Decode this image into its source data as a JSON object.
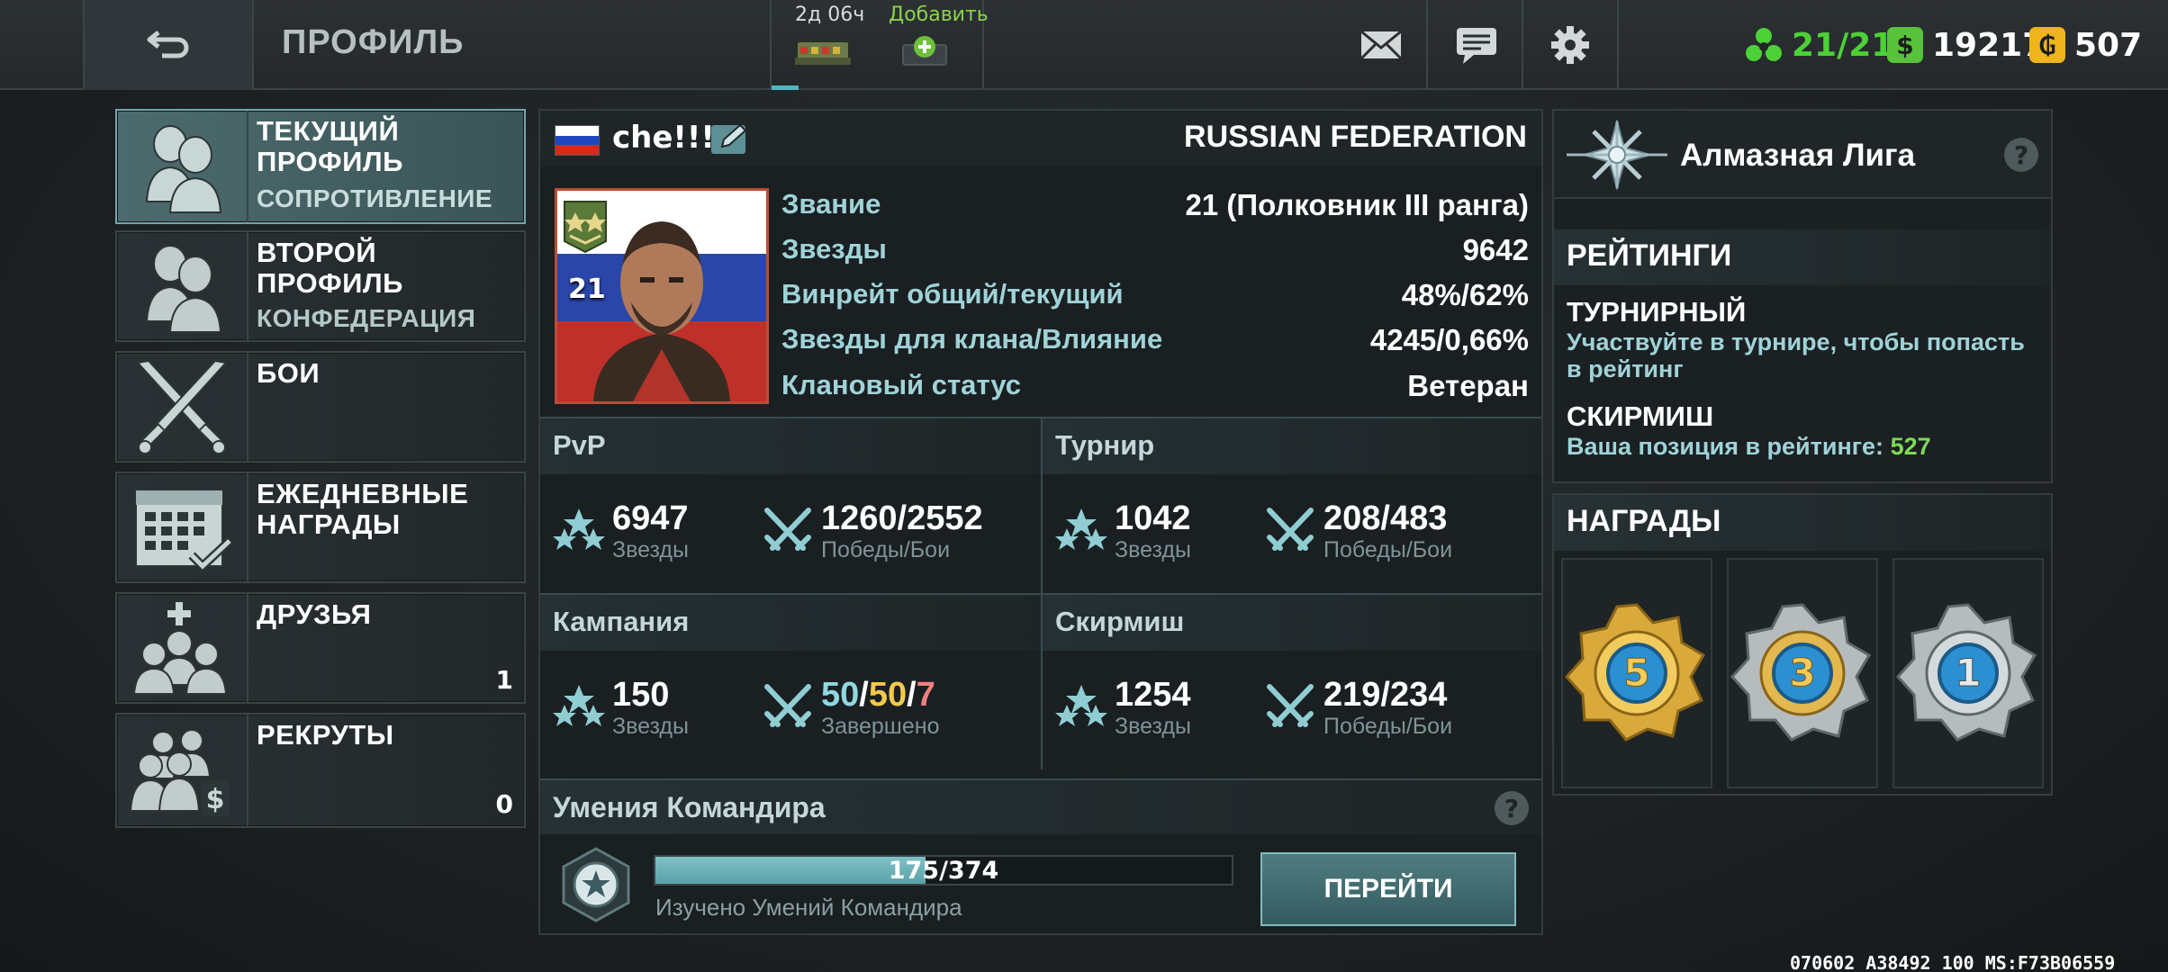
{
  "topbar": {
    "title": "ПРОФИЛЬ",
    "bonus_timer": "2д 06ч",
    "bonus_add": "Добавить",
    "resources": {
      "energy": "21/21",
      "money": "19217",
      "gold": "507"
    },
    "colors": {
      "energy": "#4cd137",
      "money": "#58c23a",
      "gold": "#f0b41c"
    }
  },
  "menu": {
    "current": {
      "title1": "ТЕКУЩИЙ",
      "title2": "ПРОФИЛЬ",
      "sub": "СОПРОТИВЛЕНИЕ"
    },
    "second": {
      "title1": "ВТОРОЙ",
      "title2": "ПРОФИЛЬ",
      "sub": "КОНФЕДЕРАЦИЯ"
    },
    "battles": {
      "title": "БОИ"
    },
    "daily": {
      "title1": "ЕЖЕДНЕВНЫЕ",
      "title2": "НАГРАДЫ"
    },
    "friends": {
      "title": "ДРУЗЬЯ",
      "count": "1"
    },
    "recruits": {
      "title": "РЕКРУТЫ",
      "count": "0"
    }
  },
  "profile": {
    "nickname": "che!!!",
    "country": "RUSSIAN FEDERATION",
    "level": "21",
    "stats": [
      {
        "label": "Звание",
        "value": "21 (Полковник III ранга)"
      },
      {
        "label": "Звезды",
        "value": "9642"
      },
      {
        "label": "Винрейт общий/текущий",
        "value": "48%/62%"
      },
      {
        "label": "Звезды для клана/Влияние",
        "value": "4245/0,66%"
      },
      {
        "label": "Клановый статус",
        "value": "Ветеран"
      }
    ]
  },
  "modes": {
    "pvp": {
      "title": "PvP",
      "stars": "6947",
      "stars_label": "Звезды",
      "wins": "1260/2552",
      "wins_label": "Победы/Бои"
    },
    "tournament": {
      "title": "Турнир",
      "stars": "1042",
      "stars_label": "Звезды",
      "wins": "208/483",
      "wins_label": "Победы/Бои"
    },
    "campaign": {
      "title": "Кампания",
      "stars": "150",
      "stars_label": "Звезды",
      "done_a": "50",
      "done_b": "50",
      "done_c": "7",
      "done_label": "Завершено"
    },
    "skirmish": {
      "title": "Скирмиш",
      "stars": "1254",
      "stars_label": "Звезды",
      "wins": "219/234",
      "wins_label": "Победы/Бои"
    }
  },
  "skills": {
    "title": "Умения Командира",
    "progress_text": "175/374",
    "progress_fraction": 0.468,
    "label": "Изучено Умений Командира",
    "button": "ПЕРЕЙТИ"
  },
  "league": {
    "name": "Алмазная Лига"
  },
  "ratings": {
    "header": "РЕЙТИНГИ",
    "tournament_name": "ТУРНИРНЫЙ",
    "tournament_desc": "Участвуйте в турнире, чтобы попасть в рейтинг",
    "skirmish_name": "СКИРМИШ",
    "skirmish_desc": "Ваша позиция в рейтинге:",
    "skirmish_pos": "527"
  },
  "awards": {
    "header": "НАГРАДЫ",
    "medals": [
      {
        "number": "5",
        "tier": "gold"
      },
      {
        "number": "3",
        "tier": "silver-gold"
      },
      {
        "number": "1",
        "tier": "silver"
      }
    ]
  },
  "debug": "070602 A38492 100 MS:F73B06559"
}
